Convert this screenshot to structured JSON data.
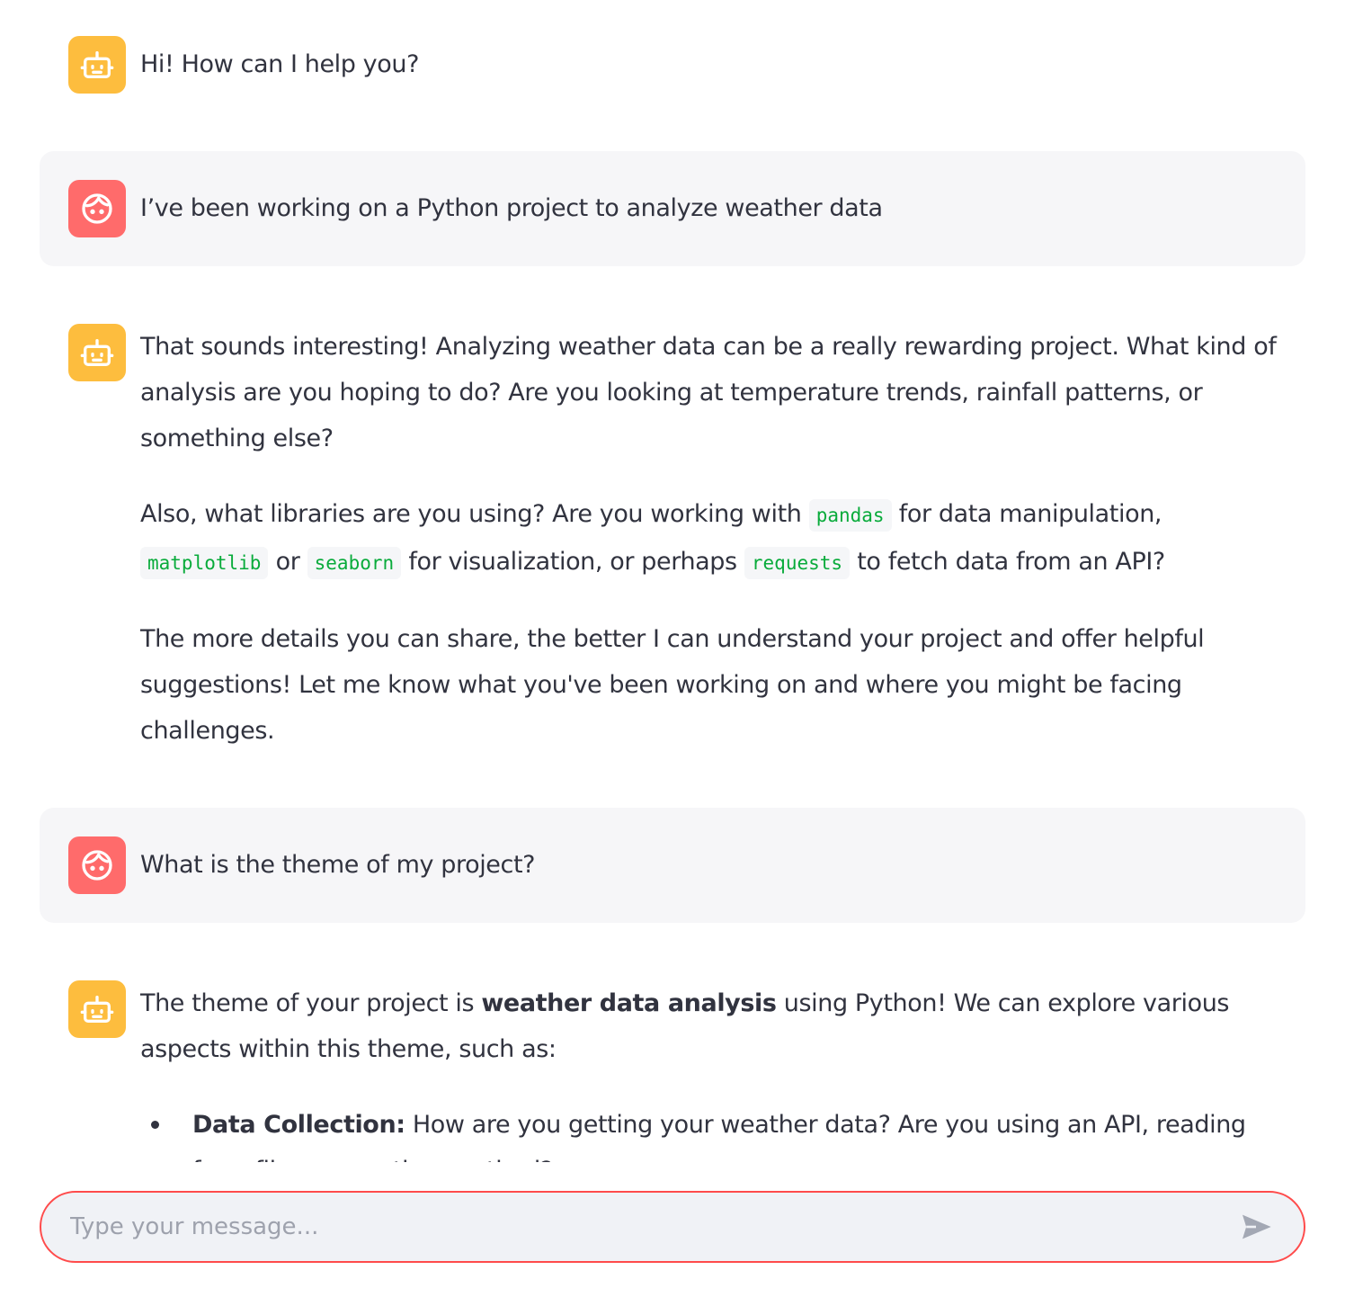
{
  "messages": [
    {
      "role": "assistant",
      "avatar_icon": "robot-icon",
      "text": "Hi! How can I help you?"
    },
    {
      "role": "user",
      "avatar_icon": "face-icon",
      "text": "I’ve been working on a Python project to analyze weather data"
    },
    {
      "role": "assistant",
      "avatar_icon": "robot-icon",
      "paragraphs": [
        "That sounds interesting! Analyzing weather data can be a really rewarding project. What kind of analysis are you hoping to do? Are you looking at temperature trends, rainfall patterns, or something else?",
        {
          "t1": "Also, what libraries are you using? Are you working with",
          "c1": "pandas",
          "t2": "for data manipulation,",
          "c2": "matplotlib",
          "t3": "or",
          "c3": "seaborn",
          "t4": "for visualization, or perhaps",
          "c4": "requests",
          "t5": "to fetch data from an API?"
        },
        "The more details you can share, the better I can understand your project and offer helpful suggestions! Let me know what you've been working on and where you might be facing challenges."
      ]
    },
    {
      "role": "user",
      "avatar_icon": "face-icon",
      "text": "What is the theme of my project?"
    },
    {
      "role": "assistant",
      "avatar_icon": "robot-icon",
      "intro_before": "The theme of your project is",
      "intro_bold": "weather data analysis",
      "intro_after": "using Python! We can explore various aspects within this theme, such as:",
      "bullets": [
        {
          "label": "Data Collection:",
          "text": "How are you getting your weather data? Are you using an API, reading from files, or another method?"
        }
      ]
    }
  ],
  "input": {
    "placeholder": "Type your message..."
  },
  "colors": {
    "bot_avatar": "#fdbd3e",
    "user_avatar": "#ff6b6b",
    "accent": "#ff4b4b",
    "code": "#09ab3b"
  }
}
